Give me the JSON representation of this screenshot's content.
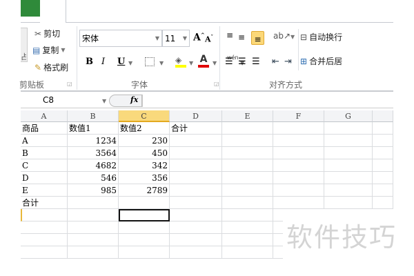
{
  "ribbon": {
    "clipboard": {
      "paste_label": "占",
      "cut": "剪切",
      "copy": "复制",
      "format_painter": "格式刷",
      "group_label": "剪贴板"
    },
    "font": {
      "font_name": "宋体",
      "font_size": "11",
      "bold": "B",
      "italic": "I",
      "underline": "U",
      "phonetic": "wén",
      "group_label": "字体"
    },
    "alignment": {
      "wrap_text": "自动换行",
      "merge_center": "合并后居",
      "group_label": "对齐方式"
    }
  },
  "formula_bar": {
    "name_box": "C8",
    "fx": "fx",
    "formula": ""
  },
  "columns": [
    "A",
    "B",
    "C",
    "D",
    "E",
    "F",
    "G"
  ],
  "selected_column": "C",
  "rows": [
    [
      "商品",
      "数值1",
      "数值2",
      "合计"
    ],
    [
      "A",
      "1234",
      "230",
      ""
    ],
    [
      "B",
      "3564",
      "450",
      ""
    ],
    [
      "C",
      "4682",
      "342",
      ""
    ],
    [
      "D",
      "546",
      "356",
      ""
    ],
    [
      "E",
      "985",
      "2789",
      ""
    ],
    [
      "合计",
      "",
      "",
      ""
    ]
  ],
  "watermark": "软件技巧"
}
